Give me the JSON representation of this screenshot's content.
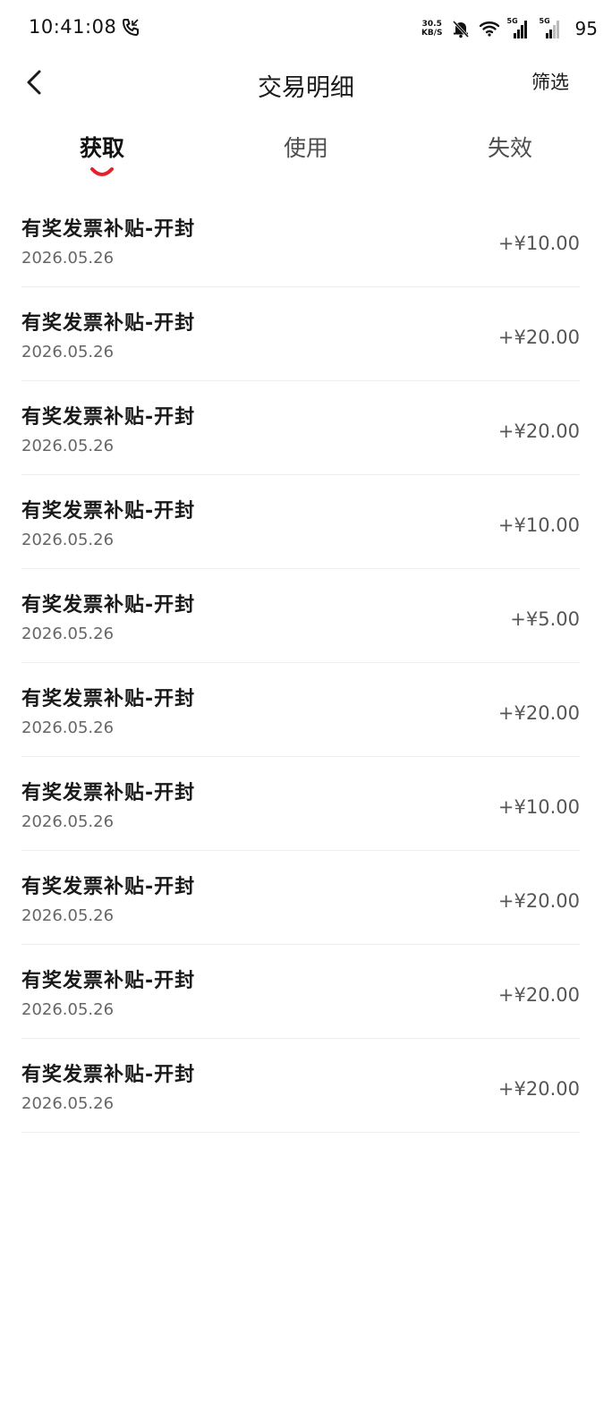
{
  "status": {
    "time": "10:41:08",
    "net_speed_value": "30.5",
    "net_speed_unit": "KB/S",
    "sim1": "5G",
    "sim2": "5G",
    "battery": "95"
  },
  "header": {
    "title": "交易明细",
    "filter_label": "筛选"
  },
  "tabs": [
    {
      "label": "获取",
      "active": true
    },
    {
      "label": "使用",
      "active": false
    },
    {
      "label": "失效",
      "active": false
    }
  ],
  "colors": {
    "accent": "#e5212d",
    "divider": "#ededed"
  },
  "transactions": [
    {
      "title": "有奖发票补贴-开封",
      "date": "2026.05.26",
      "amount": "+¥10.00"
    },
    {
      "title": "有奖发票补贴-开封",
      "date": "2026.05.26",
      "amount": "+¥20.00"
    },
    {
      "title": "有奖发票补贴-开封",
      "date": "2026.05.26",
      "amount": "+¥20.00"
    },
    {
      "title": "有奖发票补贴-开封",
      "date": "2026.05.26",
      "amount": "+¥10.00"
    },
    {
      "title": "有奖发票补贴-开封",
      "date": "2026.05.26",
      "amount": "+¥5.00"
    },
    {
      "title": "有奖发票补贴-开封",
      "date": "2026.05.26",
      "amount": "+¥20.00"
    },
    {
      "title": "有奖发票补贴-开封",
      "date": "2026.05.26",
      "amount": "+¥10.00"
    },
    {
      "title": "有奖发票补贴-开封",
      "date": "2026.05.26",
      "amount": "+¥20.00"
    },
    {
      "title": "有奖发票补贴-开封",
      "date": "2026.05.26",
      "amount": "+¥20.00"
    },
    {
      "title": "有奖发票补贴-开封",
      "date": "2026.05.26",
      "amount": "+¥20.00"
    }
  ]
}
